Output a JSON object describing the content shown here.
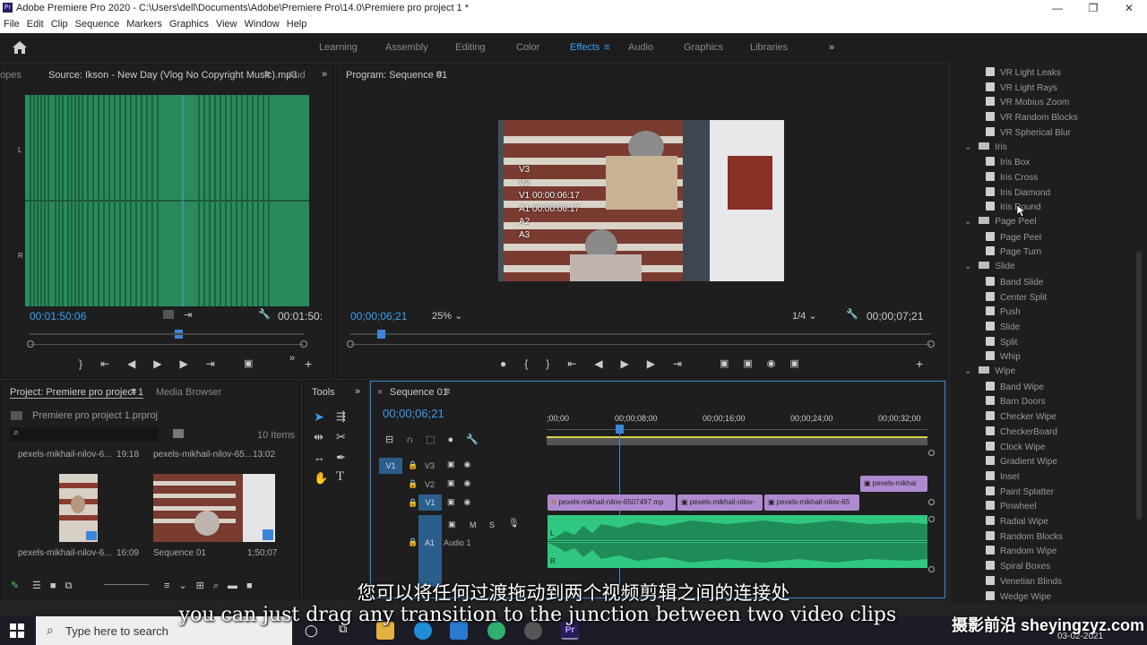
{
  "window": {
    "title": "Adobe Premiere Pro 2020 - C:\\Users\\dell\\Documents\\Adobe\\Premiere Pro\\14.0\\Premiere pro project 1 *"
  },
  "menu": [
    "File",
    "Edit",
    "Clip",
    "Sequence",
    "Markers",
    "Graphics",
    "View",
    "Window",
    "Help"
  ],
  "workspaces": [
    "Learning",
    "Assembly",
    "Editing",
    "Color",
    "Effects",
    "Audio",
    "Graphics",
    "Libraries"
  ],
  "active_workspace": "Effects",
  "source": {
    "tab_left": "opes",
    "tab": "Source: Ikson - New Day (Vlog No Copyright Music).mp3",
    "tab_right": "Aud",
    "timecode_in": "00:01:50:06",
    "timecode_out": "00:01:50:",
    "ch_l": "L",
    "ch_r": "R"
  },
  "program": {
    "tab": "Program: Sequence 01",
    "timecode": "00;00;06;21",
    "zoom": "25%",
    "quality": "1/4",
    "duration": "00;00;07;21",
    "overlay": [
      "V3",
      "V2",
      "V1 00:00:06:17",
      "A1 00:00:06:17",
      "A2",
      "A3"
    ]
  },
  "project": {
    "tab": "Project: Premiere pro project 1",
    "tab2": "Media Browser",
    "file": "Premiere pro project 1.prproj",
    "items_count": "10 Items",
    "items": [
      {
        "name": "pexels-mikhail-nilov-6...",
        "dur": "19:18"
      },
      {
        "name": "pexels-mikhail-nilov-65...",
        "dur": "13:02"
      },
      {
        "name": "pexels-mikhail-nilov-6...",
        "dur": "16:09"
      },
      {
        "name": "Sequence 01",
        "dur": "1;50;07"
      }
    ]
  },
  "tools": {
    "tab": "Tools"
  },
  "timeline": {
    "tab": "Sequence 01",
    "timecode": "00;00;06;21",
    "ruler": [
      ";00;00",
      "00;00;08;00",
      "00;00;16;00",
      "00;00;24;00",
      "00;00;32;00"
    ],
    "tracks": [
      "V3",
      "V2",
      "V1",
      "A1"
    ],
    "target": "V1",
    "audio_name": "Audio 1",
    "clips_v1": [
      "pexels-mikhail-nilov-6507497.mp",
      "pexels-mikhail-nilov-",
      "pexels-mikhail-nilov-65"
    ],
    "clip_v2": "pexels-mikhai",
    "m": "M",
    "s": "S",
    "l": "L",
    "r": "R"
  },
  "effects": {
    "vr_items": [
      "VR Light Leaks",
      "VR Light Rays",
      "VR Mobius Zoom",
      "VR Random Blocks",
      "VR Spherical Blur"
    ],
    "groups": [
      {
        "name": "Iris",
        "items": [
          "Iris Box",
          "Iris Cross",
          "Iris Diamond",
          "Iris Round"
        ]
      },
      {
        "name": "Page Peel",
        "items": [
          "Page Peel",
          "Page Turn"
        ]
      },
      {
        "name": "Slide",
        "items": [
          "Band Slide",
          "Center Split",
          "Push",
          "Slide",
          "Split",
          "Whip"
        ]
      },
      {
        "name": "Wipe",
        "items": [
          "Band Wipe",
          "Barn Doors",
          "Checker Wipe",
          "CheckerBoard",
          "Clock Wipe",
          "Gradient Wipe",
          "Inset",
          "Paint Splatter",
          "Pinwheel",
          "Radial Wipe",
          "Random Blocks",
          "Random Wipe",
          "Spiral Boxes",
          "Venetian Blinds",
          "Wedge Wipe"
        ]
      }
    ]
  },
  "subtitles": {
    "zh": "您可以将任何过渡拖动到两个视频剪辑之间的连接处",
    "en": "you can just drag any transition to the junction between two video clips"
  },
  "watermark": "摄影前沿 sheyingzyz.com",
  "taskbar": {
    "search_placeholder": "Type here to search",
    "date": "03-02-2021"
  }
}
